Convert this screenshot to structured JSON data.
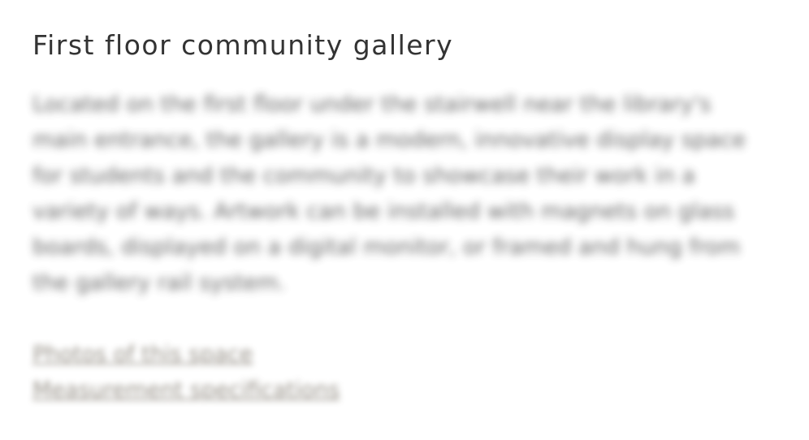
{
  "page": {
    "title": "First floor community gallery",
    "description": "Located on the first floor under the stairwell near the library's main entrance, the gallery is a modern, innovative display space for students and the community to showcase their work in a variety of ways. Artwork can be installed with magnets on glass boards, displayed on a digital monitor, or framed and hung from the gallery rail system."
  },
  "links": {
    "photos": "Photos of this space",
    "measurements": "Measurement specifications"
  },
  "colors": {
    "text": "#333333",
    "link": "#6b6356",
    "background": "#ffffff"
  }
}
